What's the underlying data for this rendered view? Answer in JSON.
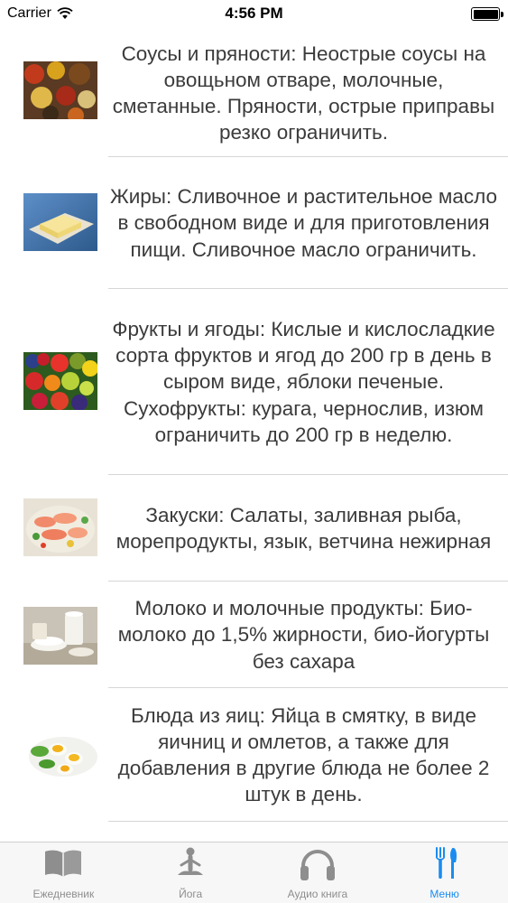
{
  "status_bar": {
    "carrier": "Carrier",
    "time": "4:56 PM"
  },
  "items": [
    {
      "icon": "spices-image",
      "text": "Соусы и пряности: Неострые соусы на овощьном отваре, молочные, сметанные. Пряности, острые приправы резко ограничить."
    },
    {
      "icon": "butter-image",
      "text": "Жиры: Сливочное и растительное масло в свободном виде и для приготовления пищи. Сливочное масло ограничить."
    },
    {
      "icon": "fruits-image",
      "text": "Фрукты и ягоды: Кислые и кислосладкие сорта фруктов и ягод до 200 гр в день в сыром виде, яблоки печеные. Сухофрукты: курага, чернослив, изюм ограничить до 200 гр в неделю."
    },
    {
      "icon": "appetizers-image",
      "text": "Закуски: Салаты, заливная рыба, морепродукты, язык, ветчина нежирная"
    },
    {
      "icon": "dairy-image",
      "text": "Молоко и молочные продукты: Био-молоко до 1,5% жирности, био-йогурты без сахара"
    },
    {
      "icon": "eggs-image",
      "text": "Блюда из яиц: Яйца в смятку, в виде яичниц и омлетов, а также для добавления в другие блюда не более 2 штук в день."
    }
  ],
  "tabs": [
    {
      "icon": "book-icon",
      "label": "Ежедневник",
      "active": false
    },
    {
      "icon": "yoga-icon",
      "label": "Йога",
      "active": false
    },
    {
      "icon": "headphones-icon",
      "label": "Аудио книга",
      "active": false
    },
    {
      "icon": "fork-knife-icon",
      "label": "Меню",
      "active": true
    }
  ],
  "colors": {
    "accent": "#1a8cf0",
    "inactive": "#8e8e8e"
  }
}
